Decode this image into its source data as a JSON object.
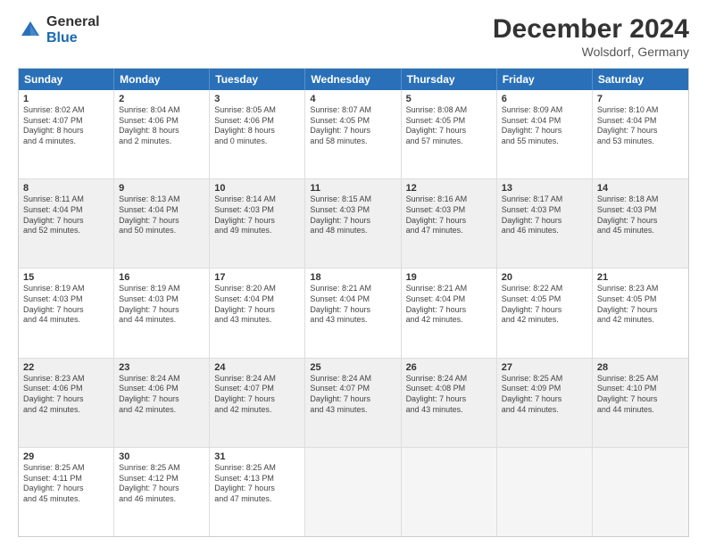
{
  "logo": {
    "general": "General",
    "blue": "Blue"
  },
  "title": "December 2024",
  "location": "Wolsdorf, Germany",
  "days": [
    "Sunday",
    "Monday",
    "Tuesday",
    "Wednesday",
    "Thursday",
    "Friday",
    "Saturday"
  ],
  "weeks": [
    [
      {
        "day": "1",
        "sunrise": "Sunrise: 8:02 AM",
        "sunset": "Sunset: 4:07 PM",
        "daylight": "Daylight: 8 hours and 4 minutes."
      },
      {
        "day": "2",
        "sunrise": "Sunrise: 8:04 AM",
        "sunset": "Sunset: 4:06 PM",
        "daylight": "Daylight: 8 hours and 2 minutes."
      },
      {
        "day": "3",
        "sunrise": "Sunrise: 8:05 AM",
        "sunset": "Sunset: 4:06 PM",
        "daylight": "Daylight: 8 hours and 0 minutes."
      },
      {
        "day": "4",
        "sunrise": "Sunrise: 8:07 AM",
        "sunset": "Sunset: 4:05 PM",
        "daylight": "Daylight: 7 hours and 58 minutes."
      },
      {
        "day": "5",
        "sunrise": "Sunrise: 8:08 AM",
        "sunset": "Sunset: 4:05 PM",
        "daylight": "Daylight: 7 hours and 57 minutes."
      },
      {
        "day": "6",
        "sunrise": "Sunrise: 8:09 AM",
        "sunset": "Sunset: 4:04 PM",
        "daylight": "Daylight: 7 hours and 55 minutes."
      },
      {
        "day": "7",
        "sunrise": "Sunrise: 8:10 AM",
        "sunset": "Sunset: 4:04 PM",
        "daylight": "Daylight: 7 hours and 53 minutes."
      }
    ],
    [
      {
        "day": "8",
        "sunrise": "Sunrise: 8:11 AM",
        "sunset": "Sunset: 4:04 PM",
        "daylight": "Daylight: 7 hours and 52 minutes."
      },
      {
        "day": "9",
        "sunrise": "Sunrise: 8:13 AM",
        "sunset": "Sunset: 4:04 PM",
        "daylight": "Daylight: 7 hours and 50 minutes."
      },
      {
        "day": "10",
        "sunrise": "Sunrise: 8:14 AM",
        "sunset": "Sunset: 4:03 PM",
        "daylight": "Daylight: 7 hours and 49 minutes."
      },
      {
        "day": "11",
        "sunrise": "Sunrise: 8:15 AM",
        "sunset": "Sunset: 4:03 PM",
        "daylight": "Daylight: 7 hours and 48 minutes."
      },
      {
        "day": "12",
        "sunrise": "Sunrise: 8:16 AM",
        "sunset": "Sunset: 4:03 PM",
        "daylight": "Daylight: 7 hours and 47 minutes."
      },
      {
        "day": "13",
        "sunrise": "Sunrise: 8:17 AM",
        "sunset": "Sunset: 4:03 PM",
        "daylight": "Daylight: 7 hours and 46 minutes."
      },
      {
        "day": "14",
        "sunrise": "Sunrise: 8:18 AM",
        "sunset": "Sunset: 4:03 PM",
        "daylight": "Daylight: 7 hours and 45 minutes."
      }
    ],
    [
      {
        "day": "15",
        "sunrise": "Sunrise: 8:19 AM",
        "sunset": "Sunset: 4:03 PM",
        "daylight": "Daylight: 7 hours and 44 minutes."
      },
      {
        "day": "16",
        "sunrise": "Sunrise: 8:19 AM",
        "sunset": "Sunset: 4:03 PM",
        "daylight": "Daylight: 7 hours and 44 minutes."
      },
      {
        "day": "17",
        "sunrise": "Sunrise: 8:20 AM",
        "sunset": "Sunset: 4:04 PM",
        "daylight": "Daylight: 7 hours and 43 minutes."
      },
      {
        "day": "18",
        "sunrise": "Sunrise: 8:21 AM",
        "sunset": "Sunset: 4:04 PM",
        "daylight": "Daylight: 7 hours and 43 minutes."
      },
      {
        "day": "19",
        "sunrise": "Sunrise: 8:21 AM",
        "sunset": "Sunset: 4:04 PM",
        "daylight": "Daylight: 7 hours and 42 minutes."
      },
      {
        "day": "20",
        "sunrise": "Sunrise: 8:22 AM",
        "sunset": "Sunset: 4:05 PM",
        "daylight": "Daylight: 7 hours and 42 minutes."
      },
      {
        "day": "21",
        "sunrise": "Sunrise: 8:23 AM",
        "sunset": "Sunset: 4:05 PM",
        "daylight": "Daylight: 7 hours and 42 minutes."
      }
    ],
    [
      {
        "day": "22",
        "sunrise": "Sunrise: 8:23 AM",
        "sunset": "Sunset: 4:06 PM",
        "daylight": "Daylight: 7 hours and 42 minutes."
      },
      {
        "day": "23",
        "sunrise": "Sunrise: 8:24 AM",
        "sunset": "Sunset: 4:06 PM",
        "daylight": "Daylight: 7 hours and 42 minutes."
      },
      {
        "day": "24",
        "sunrise": "Sunrise: 8:24 AM",
        "sunset": "Sunset: 4:07 PM",
        "daylight": "Daylight: 7 hours and 42 minutes."
      },
      {
        "day": "25",
        "sunrise": "Sunrise: 8:24 AM",
        "sunset": "Sunset: 4:07 PM",
        "daylight": "Daylight: 7 hours and 43 minutes."
      },
      {
        "day": "26",
        "sunrise": "Sunrise: 8:24 AM",
        "sunset": "Sunset: 4:08 PM",
        "daylight": "Daylight: 7 hours and 43 minutes."
      },
      {
        "day": "27",
        "sunrise": "Sunrise: 8:25 AM",
        "sunset": "Sunset: 4:09 PM",
        "daylight": "Daylight: 7 hours and 44 minutes."
      },
      {
        "day": "28",
        "sunrise": "Sunrise: 8:25 AM",
        "sunset": "Sunset: 4:10 PM",
        "daylight": "Daylight: 7 hours and 44 minutes."
      }
    ],
    [
      {
        "day": "29",
        "sunrise": "Sunrise: 8:25 AM",
        "sunset": "Sunset: 4:11 PM",
        "daylight": "Daylight: 7 hours and 45 minutes."
      },
      {
        "day": "30",
        "sunrise": "Sunrise: 8:25 AM",
        "sunset": "Sunset: 4:12 PM",
        "daylight": "Daylight: 7 hours and 46 minutes."
      },
      {
        "day": "31",
        "sunrise": "Sunrise: 8:25 AM",
        "sunset": "Sunset: 4:13 PM",
        "daylight": "Daylight: 7 hours and 47 minutes."
      },
      null,
      null,
      null,
      null
    ]
  ]
}
